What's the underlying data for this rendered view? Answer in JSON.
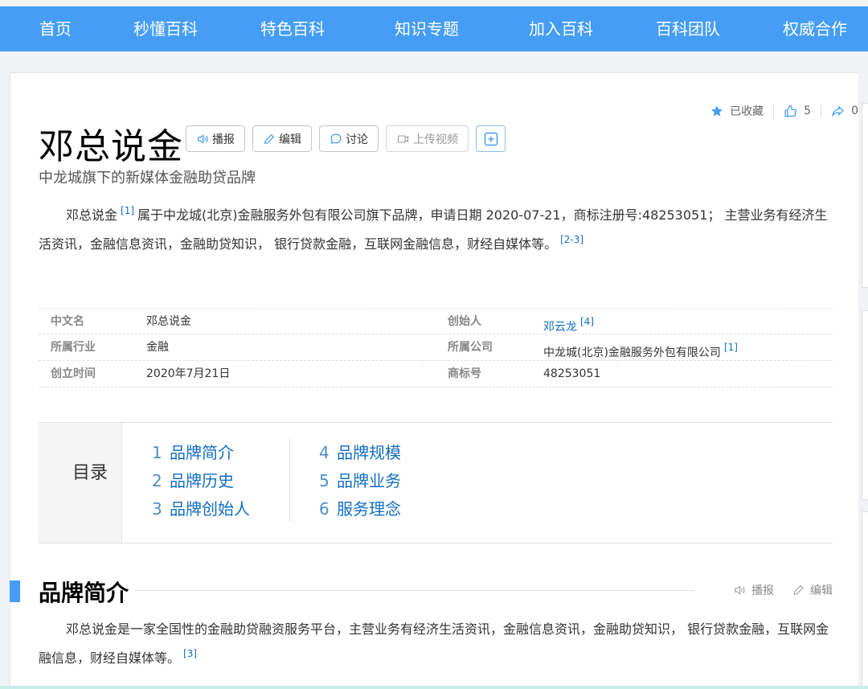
{
  "nav": {
    "items": [
      "首页",
      "秒懂百科",
      "特色百科",
      "知识专题",
      "加入百科",
      "百科团队",
      "权威合作"
    ]
  },
  "stats": {
    "collected_label": "已收藏",
    "likes": "5",
    "shares": "0"
  },
  "entry": {
    "title": "邓总说金",
    "subtitle": "中龙城旗下的新媒体金融助贷品牌",
    "buttons": {
      "broadcast": "播报",
      "edit": "编辑",
      "discuss": "讨论",
      "upload_video": "上传视频"
    },
    "summary": {
      "name": "邓总说金",
      "ref1": "[1]",
      "text": "属于中龙城(北京)金融服务外包有限公司旗下品牌，申请日期 2020-07-21，商标注册号:48253051； 主营业务有经济生活资讯，金融信息资讯，金融助贷知识， 银行贷款金融，互联网金融信息，财经自媒体等。",
      "ref2": "[2-3]"
    }
  },
  "basic_info": {
    "rows": [
      {
        "label1": "中文名",
        "value1": "邓总说金",
        "label2": "创始人",
        "value2": "邓云龙",
        "ref2": "[4]"
      },
      {
        "label1": "所属行业",
        "value1": "金融",
        "label2": "所属公司",
        "value2": "中龙城(北京)金融服务外包有限公司",
        "ref2": "[1]"
      },
      {
        "label1": "创立时间",
        "value1": "2020年7月21日",
        "label2": "商标号",
        "value2": "48253051",
        "ref2": ""
      }
    ]
  },
  "catalog": {
    "heading": "目录",
    "col1": [
      {
        "num": "1",
        "label": "品牌简介"
      },
      {
        "num": "2",
        "label": "品牌历史"
      },
      {
        "num": "3",
        "label": "品牌创始人"
      }
    ],
    "col2": [
      {
        "num": "4",
        "label": "品牌规模"
      },
      {
        "num": "5",
        "label": "品牌业务"
      },
      {
        "num": "6",
        "label": "服务理念"
      }
    ]
  },
  "section1": {
    "title": "品牌简介",
    "broadcast": "播报",
    "edit": "编辑",
    "text": "邓总说金是一家全国性的金融助贷融资服务平台，主营业务有经济生活资讯，金融信息资讯，金融助贷知识， 银行贷款金融，互联网金融信息，财经自媒体等。",
    "ref": "[3]"
  },
  "colors": {
    "nav_bg": "#459df5",
    "link": "#136ec2",
    "accent_mark": "#459df5"
  }
}
